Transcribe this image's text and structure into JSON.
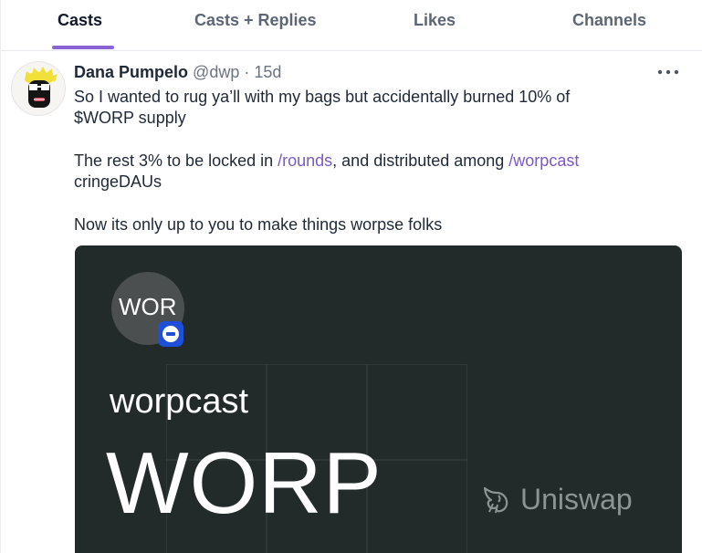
{
  "tabs": [
    {
      "label": "Casts",
      "active": true
    },
    {
      "label": "Casts + Replies",
      "active": false
    },
    {
      "label": "Likes",
      "active": false
    },
    {
      "label": "Channels",
      "active": false
    }
  ],
  "colors": {
    "accent": "#8a63d2",
    "channel_link": "#7c58c8",
    "embed_background": "#232a2a"
  },
  "cast": {
    "author_name": "Dana Pumpelo",
    "author_handle": "@dwp",
    "separator": "·",
    "timestamp": "15d",
    "more_icon": "more-horizontal-icon",
    "lines": {
      "l1": "So I wanted to rug ya’ll with my bags but accidentally burned 10% of",
      "l2": "$WORP supply",
      "l3_a": "The rest 3% to be locked in ",
      "l3_link1": "/rounds",
      "l3_b": ", and distributed among ",
      "l3_link2": "/worpcast",
      "l4": "cringeDAUs",
      "l5": "Now its only up to you to make things worpse folks"
    },
    "embed": {
      "token_symbol": "WOR",
      "name": "worpcast",
      "ticker": "WORP",
      "provider": "Uniswap",
      "provider_icon": "uniswap-unicorn-icon",
      "chain_icon": "base-chain-icon"
    }
  }
}
